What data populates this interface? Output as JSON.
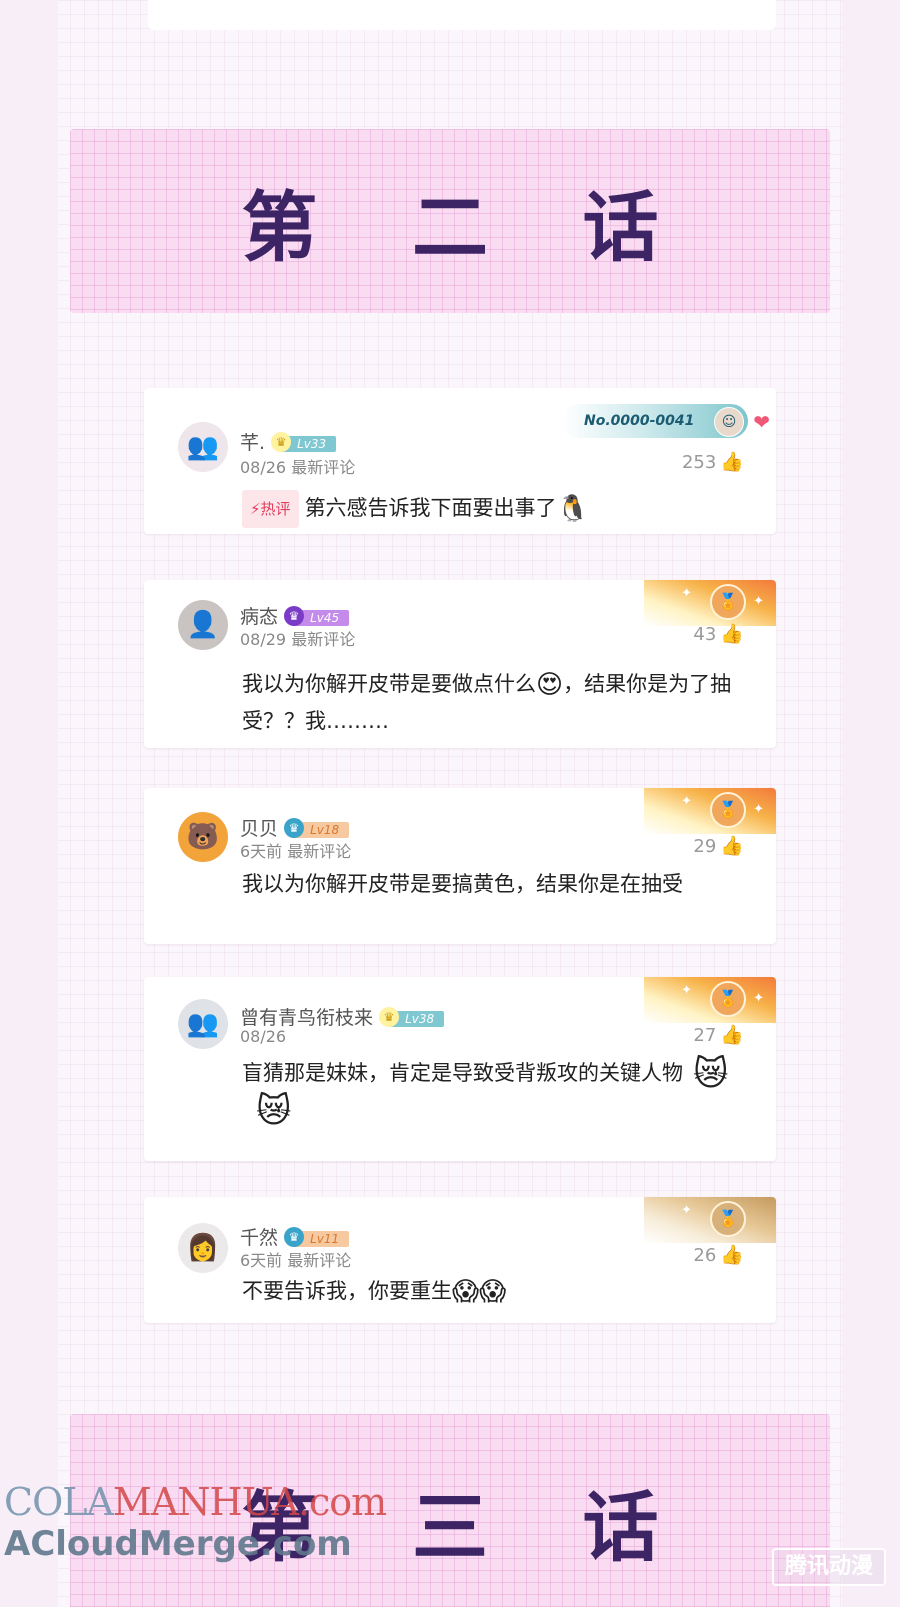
{
  "episodes": {
    "current": "第 二 话",
    "next": "第 三 话"
  },
  "comments": [
    {
      "username": "芊.",
      "level": "Lv33",
      "date": "08/26",
      "tag": "最新评论",
      "likes": "253",
      "hot_label": "热评",
      "text": "第六感告诉我下面要出事了",
      "badge_no": "No.0000-0041",
      "avatar_icon": "anime-group-avatar",
      "emojis": [
        "penguin-emoji"
      ]
    },
    {
      "username": "病态",
      "level": "Lv45",
      "date": "08/29",
      "tag": "最新评论",
      "likes": "43",
      "text_before": "我以为你解开皮带是要做点什么",
      "text_after": "，结果你是为了抽受？？我………",
      "avatar_icon": "girl-photo-avatar",
      "emojis": [
        "heart-eyes-emoji"
      ]
    },
    {
      "username": "贝贝",
      "level": "Lv18",
      "date": "6天前",
      "tag": "最新评论",
      "likes": "29",
      "text": "我以为你解开皮带是要搞黄色，结果你是在抽受",
      "avatar_icon": "orange-cartoon-avatar"
    },
    {
      "username": "曾有青鸟衔枝来",
      "level": "Lv38",
      "date": "08/26",
      "tag": "",
      "likes": "27",
      "text": "盲猜那是妹妹，肯定是导致受背叛攻的关键人物",
      "avatar_icon": "anime-group-avatar",
      "emojis": [
        "chibi-sticker",
        "chibi-sticker"
      ]
    },
    {
      "username": "千然",
      "level": "Lv11",
      "date": "6天前",
      "tag": "最新评论",
      "likes": "26",
      "text": "不要告诉我，你要重生",
      "avatar_icon": "anime-girl-avatar",
      "emojis": [
        "scream-emoji",
        "scream-emoji"
      ]
    }
  ],
  "watermarks": {
    "line1_a": "COLA",
    "line1_b": "MANHUA.com",
    "line2": "ACloudMerge.com",
    "right": "腾讯动漫"
  },
  "colors": {
    "banner_bg": "#fadcf2",
    "banner_text": "#3d2465",
    "hot_red": "#e3405d"
  }
}
